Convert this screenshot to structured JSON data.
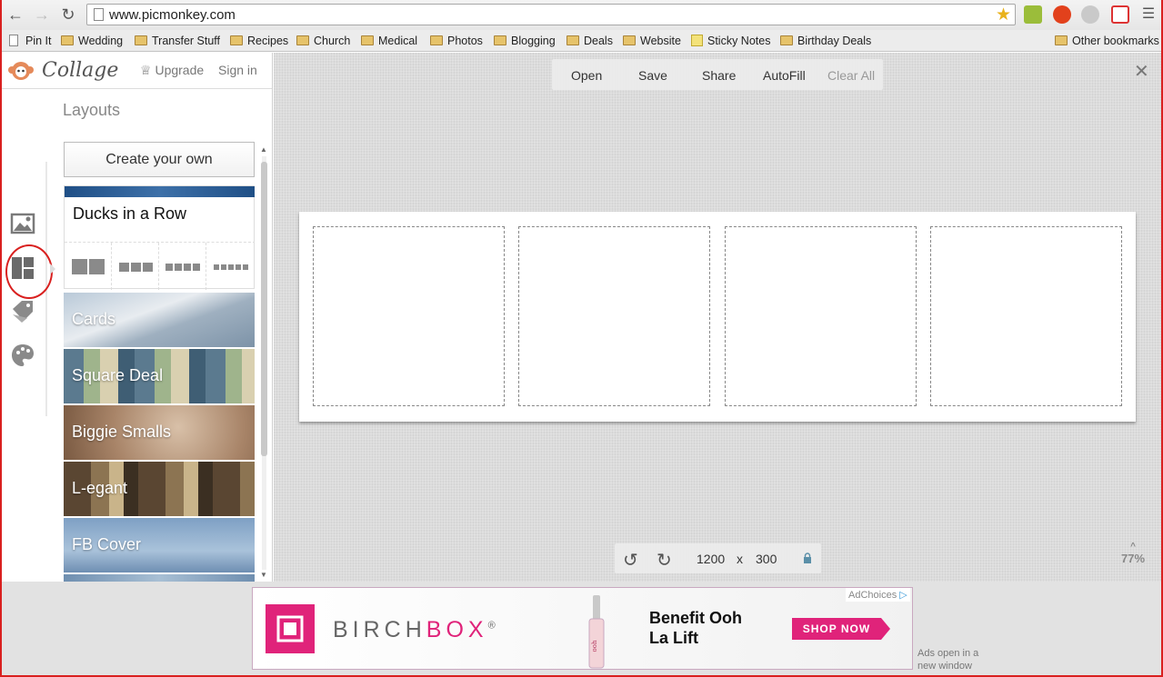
{
  "browser": {
    "url": "www.picmonkey.com",
    "bookmarks": [
      {
        "label": "Pin It",
        "icon": "page-icon"
      },
      {
        "label": "Wedding",
        "icon": "folder-icon"
      },
      {
        "label": "Transfer Stuff",
        "icon": "folder-icon"
      },
      {
        "label": "Recipes",
        "icon": "folder-icon"
      },
      {
        "label": "Church",
        "icon": "folder-icon"
      },
      {
        "label": "Medical",
        "icon": "folder-icon"
      },
      {
        "label": "Photos",
        "icon": "folder-icon"
      },
      {
        "label": "Blogging",
        "icon": "folder-icon"
      },
      {
        "label": "Deals",
        "icon": "folder-icon"
      },
      {
        "label": "Website",
        "icon": "folder-icon"
      },
      {
        "label": "Sticky Notes",
        "icon": "note-icon"
      },
      {
        "label": "Birthday Deals",
        "icon": "folder-icon"
      }
    ],
    "other_bookmarks": "Other bookmarks"
  },
  "app": {
    "logo_text": "Collage",
    "upgrade": "Upgrade",
    "sign_in": "Sign in",
    "section_title": "Layouts",
    "create_button": "Create your own",
    "ducks_title": "Ducks in a Row",
    "layouts": [
      "Cards",
      "Square Deal",
      "Biggie Smalls",
      "L-egant",
      "FB Cover"
    ],
    "accent_color": "#d9201f"
  },
  "toolbar": {
    "open": "Open",
    "save": "Save",
    "share": "Share",
    "autofill": "AutoFill",
    "clear_all": "Clear All"
  },
  "canvas": {
    "width_value": "1200",
    "times": "x",
    "height_value": "300",
    "zoom": "77%",
    "slot_count": 4
  },
  "ad": {
    "brand_left": "BIRCH",
    "brand_right": "BOX",
    "registered": "®",
    "headline_line1": "Benefit Ooh",
    "headline_line2": "La Lift",
    "cta": "SHOP NOW",
    "adchoices": "AdChoices",
    "note": "Ads open in a new window",
    "brand_color": "#e0237a"
  }
}
